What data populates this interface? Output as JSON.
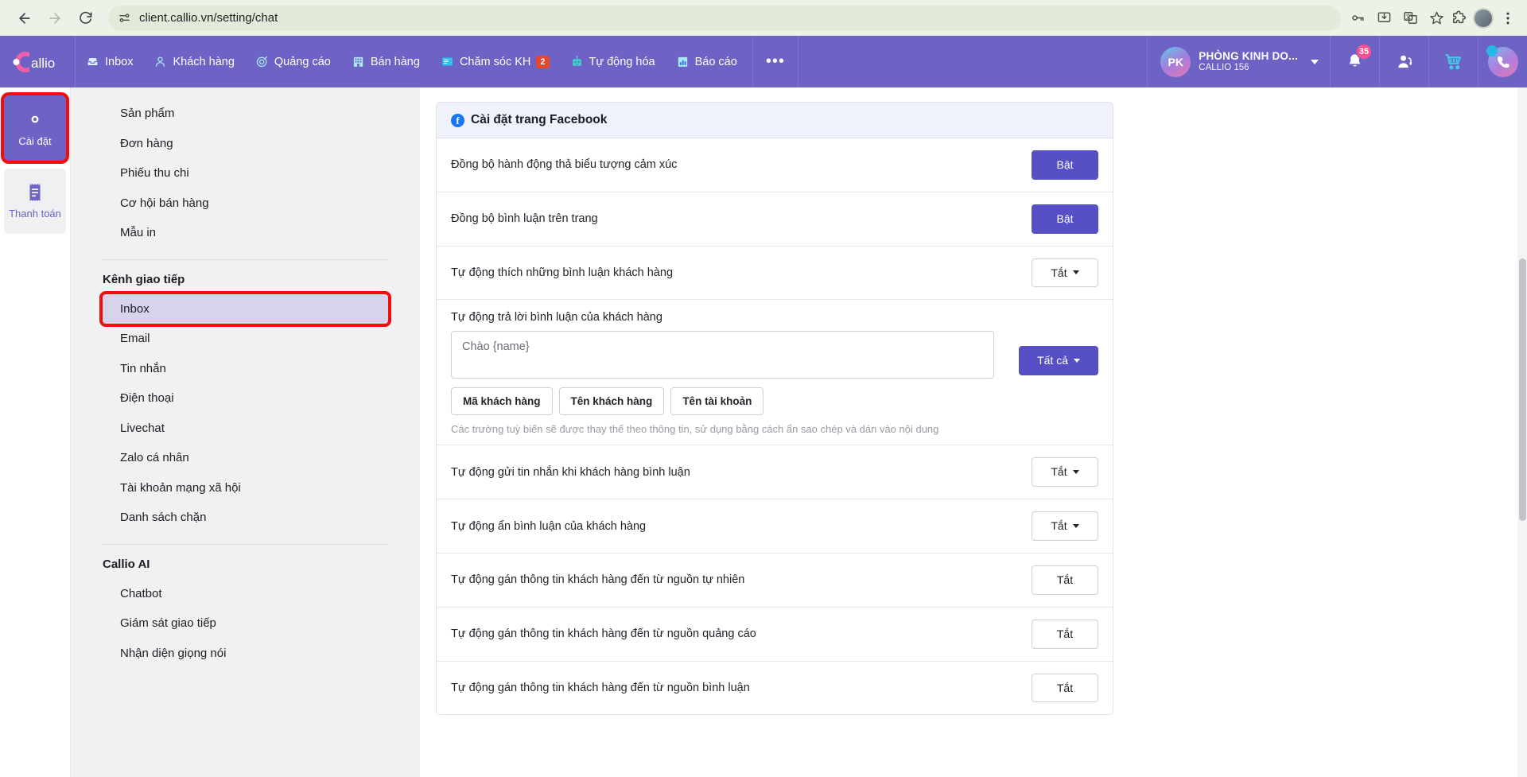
{
  "browser": {
    "url": "client.callio.vn/setting/chat",
    "back_icon": "back-arrow-icon",
    "forward_icon": "forward-arrow-icon",
    "reload_icon": "reload-icon",
    "site_info_icon": "site-settings-icon",
    "password_icon": "password-key-icon",
    "install_icon": "install-app-icon",
    "translate_icon": "translate-icon",
    "bookmark_icon": "star-icon",
    "extensions_icon": "extensions-puzzle-icon",
    "menu_icon": "kebab-menu-icon"
  },
  "header": {
    "logo_text": "Callio",
    "nav": [
      {
        "label": "Inbox",
        "icon": "inbox-icon",
        "badge": ""
      },
      {
        "label": "Khách hàng",
        "icon": "customers-icon",
        "badge": ""
      },
      {
        "label": "Quảng cáo",
        "icon": "ads-target-icon",
        "badge": ""
      },
      {
        "label": "Bán hàng",
        "icon": "sales-building-icon",
        "badge": ""
      },
      {
        "label": "Chăm sóc KH",
        "icon": "support-ticket-icon",
        "badge": "2"
      },
      {
        "label": "Tự động hóa",
        "icon": "robot-icon",
        "badge": ""
      },
      {
        "label": "Báo cáo",
        "icon": "report-chart-icon",
        "badge": ""
      }
    ],
    "more_label": "•••",
    "account": {
      "initials": "PK",
      "name": "PHÒNG KINH DO...",
      "sub": "CALLIO 156"
    },
    "notifications_count": "35",
    "icons": {
      "bell": "bell-icon",
      "agent": "headset-agent-icon",
      "cart": "shopping-cart-icon",
      "phone": "phone-call-icon"
    }
  },
  "rail": {
    "items": [
      {
        "label": "Cài đặt",
        "icon": "gear-icon",
        "active": true
      },
      {
        "label": "Thanh toán",
        "icon": "receipt-icon",
        "active": false
      }
    ]
  },
  "settings_nav": {
    "top_items": [
      "Sản phẩm",
      "Đơn hàng",
      "Phiếu thu chi",
      "Cơ hội bán hàng",
      "Mẫu in"
    ],
    "group_1_title": "Kênh giao tiếp",
    "group_1_items": [
      "Inbox",
      "Email",
      "Tin nhắn",
      "Điện thoại",
      "Livechat",
      "Zalo cá nhân",
      "Tài khoản mạng xã hội",
      "Danh sách chặn"
    ],
    "group_1_selected": "Inbox",
    "group_2_title": "Callio AI",
    "group_2_items": [
      "Chatbot",
      "Giám sát giao tiếp",
      "Nhận diện giọng nói"
    ]
  },
  "main": {
    "card_title": "Cài đặt trang Facebook",
    "card_icon": "facebook-icon",
    "rows": [
      {
        "label": "Đồng bộ hành động thả biểu tượng cảm xúc",
        "button": "Bật",
        "style": "primary",
        "caret": false
      },
      {
        "label": "Đồng bộ bình luận trên trang",
        "button": "Bật",
        "style": "primary",
        "caret": false
      },
      {
        "label": "Tự động thích những bình luận khách hàng",
        "button": "Tắt",
        "style": "outline",
        "caret": true
      }
    ],
    "auto_reply": {
      "label": "Tự động trả lời bình luận của khách hàng",
      "textarea_value": "Chào {name}",
      "chips": [
        "Mã khách hàng",
        "Tên khách hàng",
        "Tên tài khoản"
      ],
      "hint": "Các trường tuỳ biến sẽ được thay thế theo thông tin, sử dụng bằng cách ẩn sao chép và dán vào nội dung",
      "button": "Tất cả",
      "style": "primary",
      "caret": true
    },
    "rows_after": [
      {
        "label": "Tự động gửi tin nhắn khi khách hàng bình luận",
        "button": "Tắt",
        "style": "outline",
        "caret": true
      },
      {
        "label": "Tự động ẩn bình luận của khách hàng",
        "button": "Tắt",
        "style": "outline",
        "caret": true
      },
      {
        "label": "Tự động gán thông tin khách hàng đến từ nguồn tự nhiên",
        "button": "Tắt",
        "style": "outline",
        "caret": false
      },
      {
        "label": "Tự động gán thông tin khách hàng đến từ nguồn quảng cáo",
        "button": "Tắt",
        "style": "outline",
        "caret": false
      },
      {
        "label": "Tự động gán thông tin khách hàng đến từ nguồn bình luận",
        "button": "Tắt",
        "style": "outline",
        "caret": false
      }
    ]
  },
  "colors": {
    "brand_purple": "#6c63c4",
    "button_purple": "#5750c4",
    "highlight_red": "#f60b0b",
    "badge_red": "#e8472c",
    "badge_pink": "#f7508e",
    "facebook_blue": "#1877f2",
    "selected_nav": "#d5d4ea"
  }
}
